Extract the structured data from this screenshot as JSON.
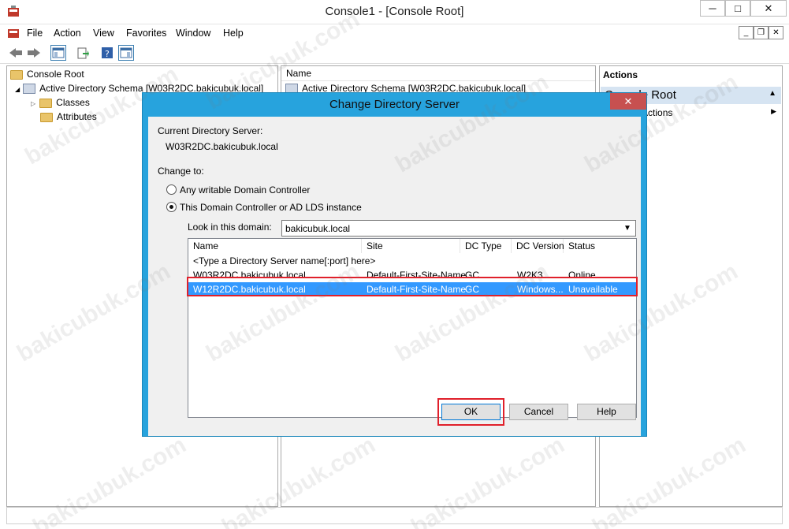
{
  "window": {
    "title": "Console1 - [Console Root]",
    "minimize": "─",
    "maximize": "□",
    "close": "✕"
  },
  "menu": [
    "File",
    "Action",
    "View",
    "Favorites",
    "Window",
    "Help"
  ],
  "tree": {
    "root": "Console Root",
    "snapin": "Active Directory Schema [W03R2DC.bakicubuk.local]",
    "children": [
      "Classes",
      "Attributes"
    ]
  },
  "result_pane": {
    "column": "Name",
    "item": "Active Directory Schema [W03R2DC.bakicubuk.local]"
  },
  "actions_pane": {
    "header": "Actions",
    "section": "Console Root",
    "item": "More Actions"
  },
  "dialog": {
    "title": "Change Directory Server",
    "current_label": "Current Directory Server:",
    "current_value": "W03R2DC.bakicubuk.local",
    "change_to_label": "Change to:",
    "option_any": "Any writable Domain Controller",
    "option_this": "This Domain Controller or AD LDS instance",
    "domain_label": "Look in this domain:",
    "domain_value": "bakicubuk.local",
    "columns": [
      "Name",
      "Site",
      "DC Type",
      "DC Version",
      "Status"
    ],
    "placeholder_row": "<Type a Directory Server name[:port] here>",
    "rows": [
      [
        "W03R2DC.bakicubuk.local",
        "Default-First-Site-Name",
        "GC",
        "W2K3",
        "Online"
      ],
      [
        "W12R2DC.bakicubuk.local",
        "Default-First-Site-Name",
        "GC",
        "Windows...",
        "Unavailable"
      ]
    ],
    "ok": "OK",
    "cancel": "Cancel",
    "help": "Help"
  },
  "watermark": "bakicubuk.com"
}
